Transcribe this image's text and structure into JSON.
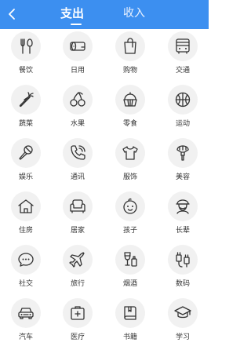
{
  "header": {
    "tabs": [
      {
        "label": "支出",
        "active": true
      },
      {
        "label": "收入",
        "active": false
      }
    ],
    "back_icon": "chevron-left-icon",
    "bar_color": "#3c8ff0"
  },
  "categories": [
    {
      "label": "餐饮",
      "icon": "fork-spoon-icon"
    },
    {
      "label": "日用",
      "icon": "tissue-roll-icon"
    },
    {
      "label": "购物",
      "icon": "shopping-bag-icon"
    },
    {
      "label": "交通",
      "icon": "bus-icon"
    },
    {
      "label": "蔬菜",
      "icon": "carrot-icon"
    },
    {
      "label": "水果",
      "icon": "cherry-icon"
    },
    {
      "label": "零食",
      "icon": "cupcake-icon"
    },
    {
      "label": "运动",
      "icon": "basketball-icon"
    },
    {
      "label": "娱乐",
      "icon": "microphone-icon"
    },
    {
      "label": "通讯",
      "icon": "phone-icon"
    },
    {
      "label": "服饰",
      "icon": "tshirt-icon"
    },
    {
      "label": "美容",
      "icon": "makeup-brush-icon"
    },
    {
      "label": "住房",
      "icon": "house-icon"
    },
    {
      "label": "居家",
      "icon": "sofa-icon"
    },
    {
      "label": "孩子",
      "icon": "baby-face-icon"
    },
    {
      "label": "长辈",
      "icon": "elder-icon"
    },
    {
      "label": "社交",
      "icon": "chat-bubble-icon"
    },
    {
      "label": "旅行",
      "icon": "airplane-icon"
    },
    {
      "label": "烟酒",
      "icon": "wine-glass-icon"
    },
    {
      "label": "数码",
      "icon": "charger-plug-icon"
    },
    {
      "label": "汽车",
      "icon": "car-icon"
    },
    {
      "label": "医疗",
      "icon": "medical-kit-icon"
    },
    {
      "label": "书籍",
      "icon": "book-icon"
    },
    {
      "label": "学习",
      "icon": "graduation-cap-icon"
    }
  ]
}
